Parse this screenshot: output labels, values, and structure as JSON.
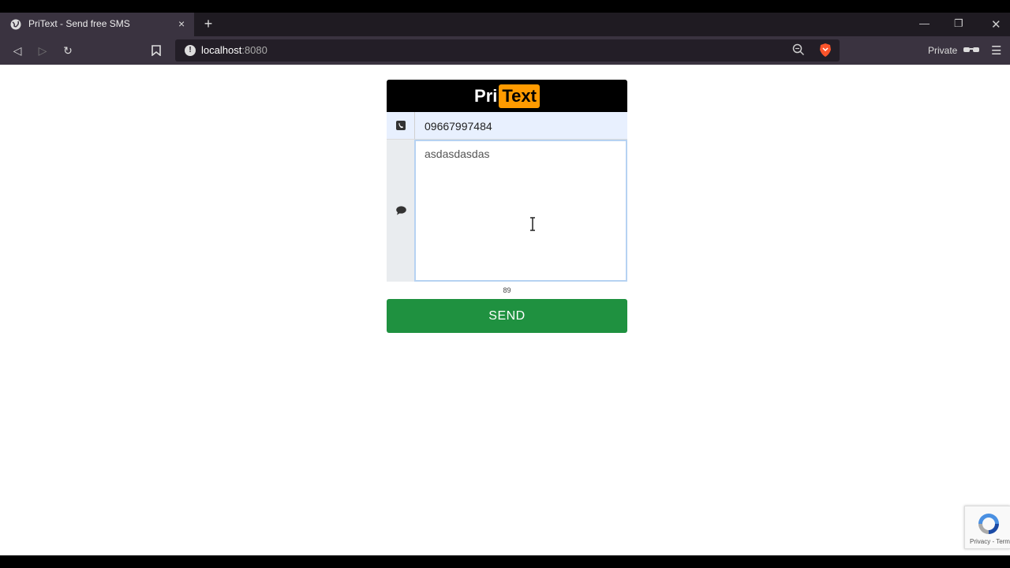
{
  "browser": {
    "tab_title": "PriText - Send free SMS",
    "tab_close": "×",
    "new_tab": "+",
    "url_host": "localhost",
    "url_port": ":8080",
    "private_label": "Private",
    "accent": "#fb542b"
  },
  "app": {
    "logo_pri": "Pri",
    "logo_text": "Text",
    "logo_accent": "#ff9a00",
    "phone_value": "09667997484",
    "message_value": "asdasdasdas",
    "char_counter": "89",
    "send_label": "SEND",
    "send_color": "#1f9140"
  },
  "recaptcha": {
    "links": "Privacy - Terms"
  }
}
